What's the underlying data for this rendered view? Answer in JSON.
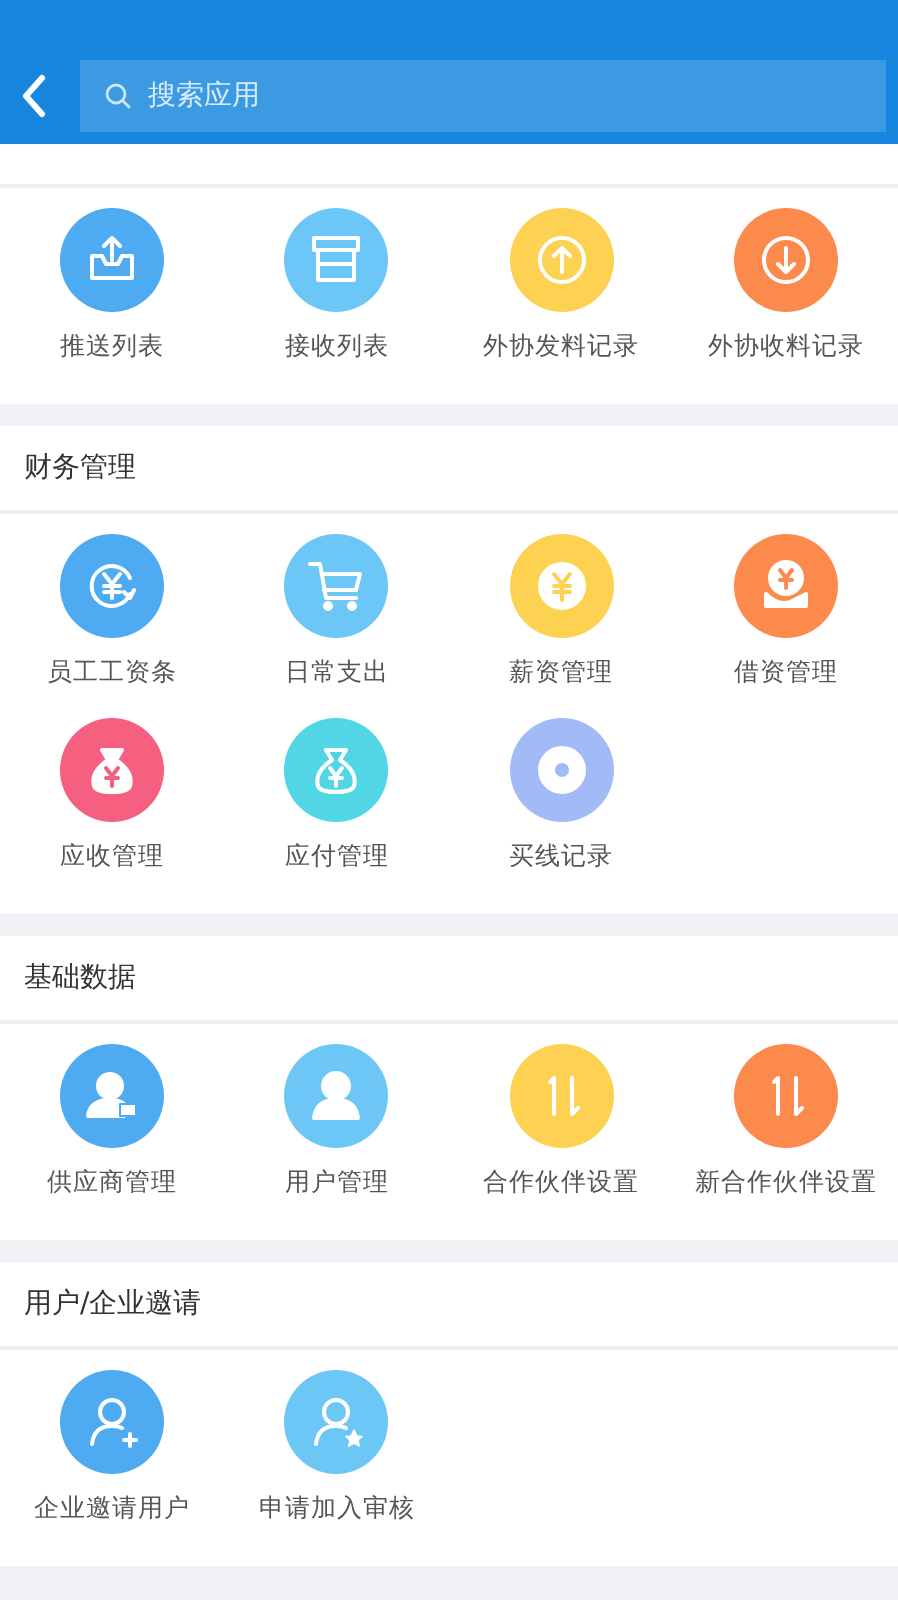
{
  "header": {
    "search": {
      "placeholder": "搜索应用"
    }
  },
  "sections": [
    {
      "items": [
        {
          "label": "推送列表",
          "color": "#4eaaf1"
        },
        {
          "label": "接收列表",
          "color": "#6cc6f6"
        },
        {
          "label": "外协发料记录",
          "color": "#fdd152"
        },
        {
          "label": "外协收料记录",
          "color": "#fc8a4c"
        }
      ]
    },
    {
      "title": "财务管理",
      "items": [
        {
          "label": "员工工资条",
          "color": "#4eaaf1"
        },
        {
          "label": "日常支出",
          "color": "#6cc6f6"
        },
        {
          "label": "薪资管理",
          "color": "#fdd152"
        },
        {
          "label": "借资管理",
          "color": "#fc8a4c"
        },
        {
          "label": "应收管理",
          "color": "#f55f80"
        },
        {
          "label": "应付管理",
          "color": "#52d6e6"
        },
        {
          "label": "买线记录",
          "color": "#a2baf6"
        }
      ]
    },
    {
      "title": "基础数据",
      "items": [
        {
          "label": "供应商管理",
          "color": "#4eaaf1"
        },
        {
          "label": "用户管理",
          "color": "#6cc6f6"
        },
        {
          "label": "合作伙伴设置",
          "color": "#fdd152"
        },
        {
          "label": "新合作伙伴设置",
          "color": "#fc8a4c"
        }
      ]
    },
    {
      "title": "用户/企业邀请",
      "items": [
        {
          "label": "企业邀请用户",
          "color": "#4eaaf1"
        },
        {
          "label": "申请加入审核",
          "color": "#6cc6f6"
        }
      ]
    }
  ]
}
